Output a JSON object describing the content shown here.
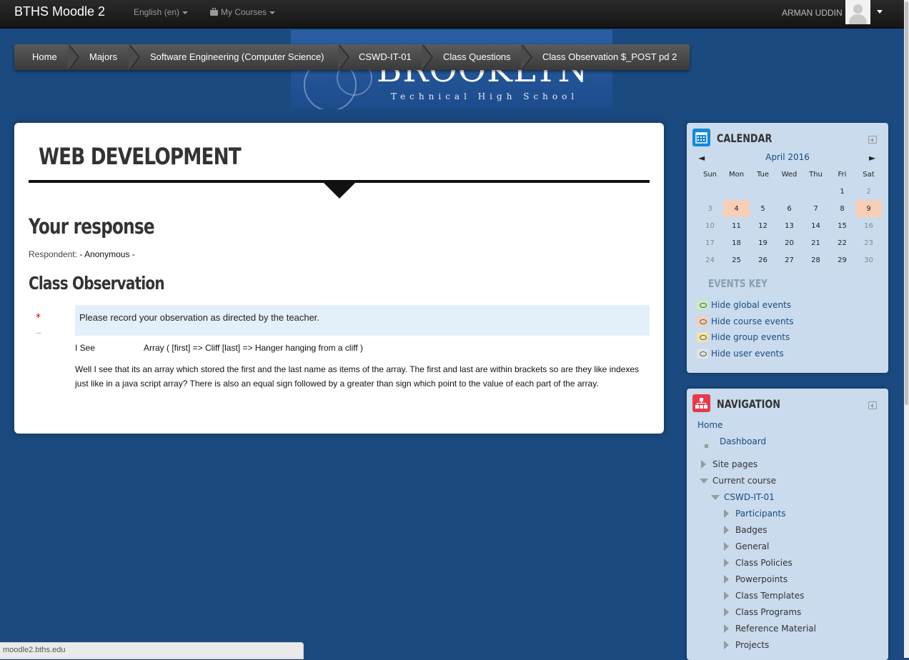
{
  "navbar": {
    "brand": "BTHS Moodle 2",
    "language": "English (en)",
    "my_courses": "My Courses",
    "user_name": "ARMAN UDDIN"
  },
  "banner": {
    "big": "BROOKLYN",
    "small": "Technical High School"
  },
  "breadcrumb": [
    "Home",
    "Majors",
    "Software Engineering (Computer Science)",
    "CSWD-IT-01",
    "Class Questions",
    "Class Observation $_POST pd 2"
  ],
  "main": {
    "course_title": "WEB DEVELOPMENT",
    "response_heading": "Your response",
    "respondent_label": "Respondent:",
    "respondent_value": "- Anonymous -",
    "section_heading": "Class Observation",
    "required_mark": "*",
    "question": "Please record your observation as directed by the teacher.",
    "i_see_label": "I See",
    "i_see_value": "Array ( [first] => Cliff [last] => Hanger hanging from a cliff )",
    "answer": "Well I see that its an array which stored the first and the last name as items of the array. The first and last are within brackets so are they like indexes just like in a java script array? There is also an equal sign followed by a greater than sign which point to the value of each part of the array."
  },
  "calendar": {
    "title": "CALENDAR",
    "month": "April 2016",
    "prev": "◄",
    "next": "►",
    "days": [
      "Sun",
      "Mon",
      "Tue",
      "Wed",
      "Thu",
      "Fri",
      "Sat"
    ],
    "weeks": [
      [
        "",
        "",
        "",
        "",
        "",
        "1",
        "2"
      ],
      [
        "3",
        "4",
        "5",
        "6",
        "7",
        "8",
        "9"
      ],
      [
        "10",
        "11",
        "12",
        "13",
        "14",
        "15",
        "16"
      ],
      [
        "17",
        "18",
        "19",
        "20",
        "21",
        "22",
        "23"
      ],
      [
        "24",
        "25",
        "26",
        "27",
        "28",
        "29",
        "30"
      ]
    ],
    "highlighted_days": [
      "4",
      "9"
    ],
    "events_key": "EVENTS KEY",
    "events": [
      {
        "label": "Hide global events",
        "color": "#c8ecc0"
      },
      {
        "label": "Hide course events",
        "color": "#f7cfb8"
      },
      {
        "label": "Hide group events",
        "color": "#f5e2a8"
      },
      {
        "label": "Hide user events",
        "color": "#dfe3e8"
      }
    ]
  },
  "navigation": {
    "title": "NAVIGATION",
    "home": "Home",
    "dashboard": "Dashboard",
    "site_pages": "Site pages",
    "current_course": "Current course",
    "course": "CSWD-IT-01",
    "course_items": [
      "Participants",
      "Badges",
      "General",
      "Class Policies",
      "Powerpoints",
      "Class Templates",
      "Class Programs",
      "Reference Material",
      "Projects"
    ]
  },
  "statusbar": {
    "url": "moodle2.bths.edu"
  }
}
